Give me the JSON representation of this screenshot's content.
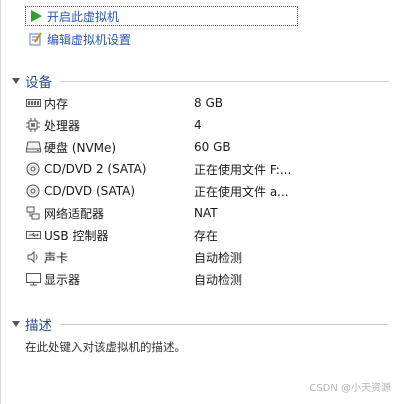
{
  "actions": {
    "power_on": "开启此虚拟机",
    "edit_settings": "编辑虚拟机设置"
  },
  "devices_section": {
    "title": "设备"
  },
  "devices": [
    {
      "icon": "memory-icon",
      "name": "内存",
      "value": "8 GB"
    },
    {
      "icon": "processor-icon",
      "name": "处理器",
      "value": "4"
    },
    {
      "icon": "hard-disk-icon",
      "name": "硬盘 (NVMe)",
      "value": "60 GB"
    },
    {
      "icon": "cd-dvd-icon",
      "name": "CD/DVD 2 (SATA)",
      "value": "正在使用文件 F:..."
    },
    {
      "icon": "cd-dvd-icon",
      "name": "CD/DVD (SATA)",
      "value": "正在使用文件 a..."
    },
    {
      "icon": "network-adapter-icon",
      "name": "网络适配器",
      "value": "NAT"
    },
    {
      "icon": "usb-icon",
      "name": "USB 控制器",
      "value": "存在"
    },
    {
      "icon": "speaker-icon",
      "name": "声卡",
      "value": "自动检测"
    },
    {
      "icon": "display-icon",
      "name": "显示器",
      "value": "自动检测"
    }
  ],
  "description_section": {
    "title": "描述",
    "placeholder": "在此处键入对该虚拟机的描述。"
  },
  "watermark": "CSDN @小天资源",
  "colors": {
    "link": "#2a56b8",
    "section_title": "#2a4a8f",
    "play_green": "#2f9e2f"
  }
}
